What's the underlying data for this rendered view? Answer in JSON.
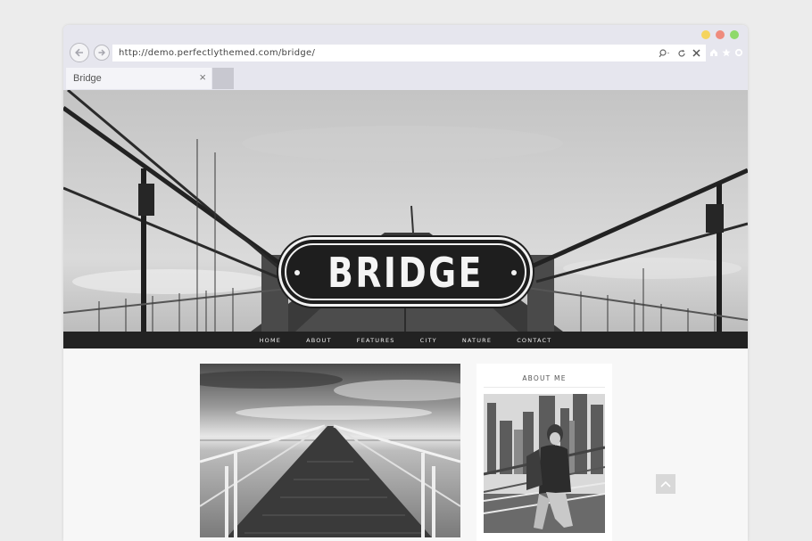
{
  "browser": {
    "url": "http://demo.perfectlythemed.com/bridge/",
    "tab_title": "Bridge",
    "tab_close": "×",
    "traffic_lights": {
      "yellow": "#f5d45e",
      "red": "#ef8b7d",
      "green": "#8fd96b"
    }
  },
  "site": {
    "logo_text": "BRIDGE",
    "menu": [
      "HOME",
      "ABOUT",
      "FEATURES",
      "CITY",
      "NATURE",
      "CONTACT"
    ]
  },
  "sidebar": {
    "title": "ABOUT ME"
  },
  "icons": {
    "back": "arrow-left-icon",
    "forward": "arrow-right-icon",
    "search": "search-icon",
    "refresh": "refresh-icon",
    "stop": "close-icon",
    "home": "home-icon",
    "favorite": "star-icon",
    "settings": "gear-icon",
    "scroll_top": "chevron-up-icon"
  }
}
